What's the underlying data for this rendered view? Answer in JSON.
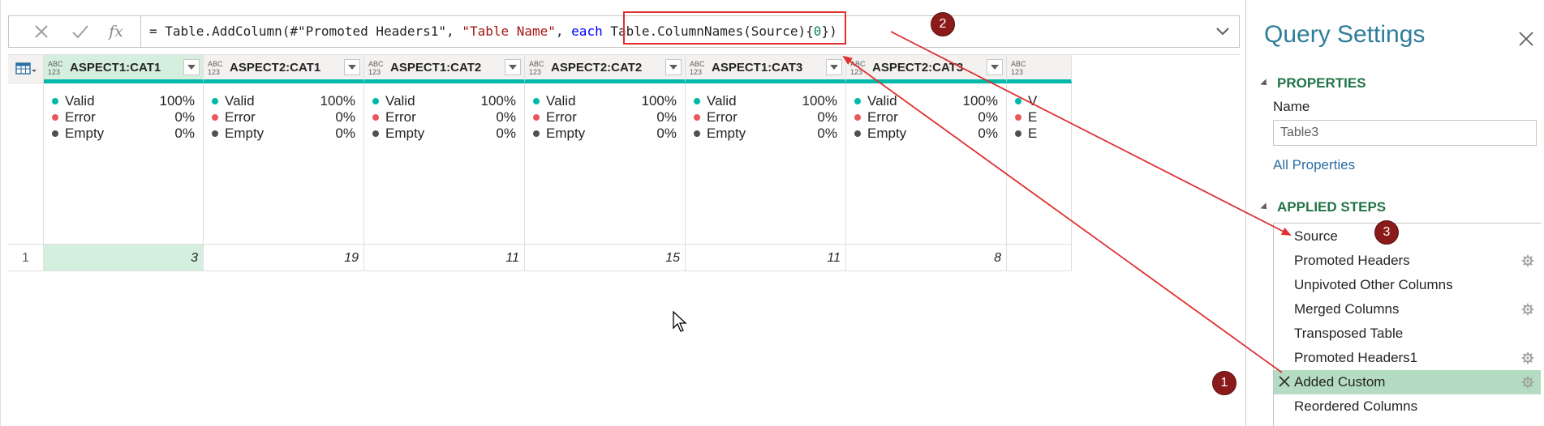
{
  "formula": {
    "cancel_icon": "close-icon",
    "commit_icon": "checkmark-icon",
    "fx_label": "fx",
    "parts": {
      "p1": "= Table.AddColumn(#\"Promoted Headers1\", ",
      "p2": "\"Table Name\"",
      "p3": ", ",
      "p4": "each",
      "p5": " Table.ColumnNames(Source){",
      "p6": "0",
      "p7": "})"
    }
  },
  "grid": {
    "type_label_top": "ABC",
    "type_label_bottom": "123",
    "columns": [
      {
        "name": "ASPECT1:CAT1",
        "valid": "100%",
        "error": "0%",
        "empty": "0%",
        "row1": "3"
      },
      {
        "name": "ASPECT2:CAT1",
        "valid": "100%",
        "error": "0%",
        "empty": "0%",
        "row1": "19"
      },
      {
        "name": "ASPECT1:CAT2",
        "valid": "100%",
        "error": "0%",
        "empty": "0%",
        "row1": "11"
      },
      {
        "name": "ASPECT2:CAT2",
        "valid": "100%",
        "error": "0%",
        "empty": "0%",
        "row1": "15"
      },
      {
        "name": "ASPECT1:CAT3",
        "valid": "100%",
        "error": "0%",
        "empty": "0%",
        "row1": "11"
      },
      {
        "name": "ASPECT2:CAT3",
        "valid": "100%",
        "error": "0%",
        "empty": "0%",
        "row1": "8"
      },
      {
        "name": "",
        "valid": "",
        "error": "",
        "empty": "",
        "row1": ""
      }
    ],
    "quality_labels": {
      "valid": "Valid",
      "error": "Error",
      "empty": "Empty"
    },
    "partial_labels": {
      "valid": "V",
      "error": "E",
      "empty": "E"
    },
    "row_number": "1"
  },
  "annotations": {
    "b1": "1",
    "b2": "2",
    "b3": "3"
  },
  "query_settings": {
    "title": "Query Settings",
    "properties_header": "PROPERTIES",
    "name_label": "Name",
    "name_value": "Table3",
    "all_properties": "All Properties",
    "applied_steps_header": "APPLIED STEPS",
    "steps": [
      {
        "name": "Source",
        "gear": false
      },
      {
        "name": "Promoted Headers",
        "gear": true
      },
      {
        "name": "Unpivoted Other Columns",
        "gear": false
      },
      {
        "name": "Merged Columns",
        "gear": true
      },
      {
        "name": "Transposed Table",
        "gear": false
      },
      {
        "name": "Promoted Headers1",
        "gear": true
      },
      {
        "name": "Added Custom",
        "gear": true
      },
      {
        "name": "Reordered Columns",
        "gear": false
      }
    ]
  },
  "colors": {
    "accent_teal": "#01b8aa",
    "selected_green": "#d5efdf",
    "annotation_red": "#e03030",
    "badge": "#8b1a1a"
  }
}
